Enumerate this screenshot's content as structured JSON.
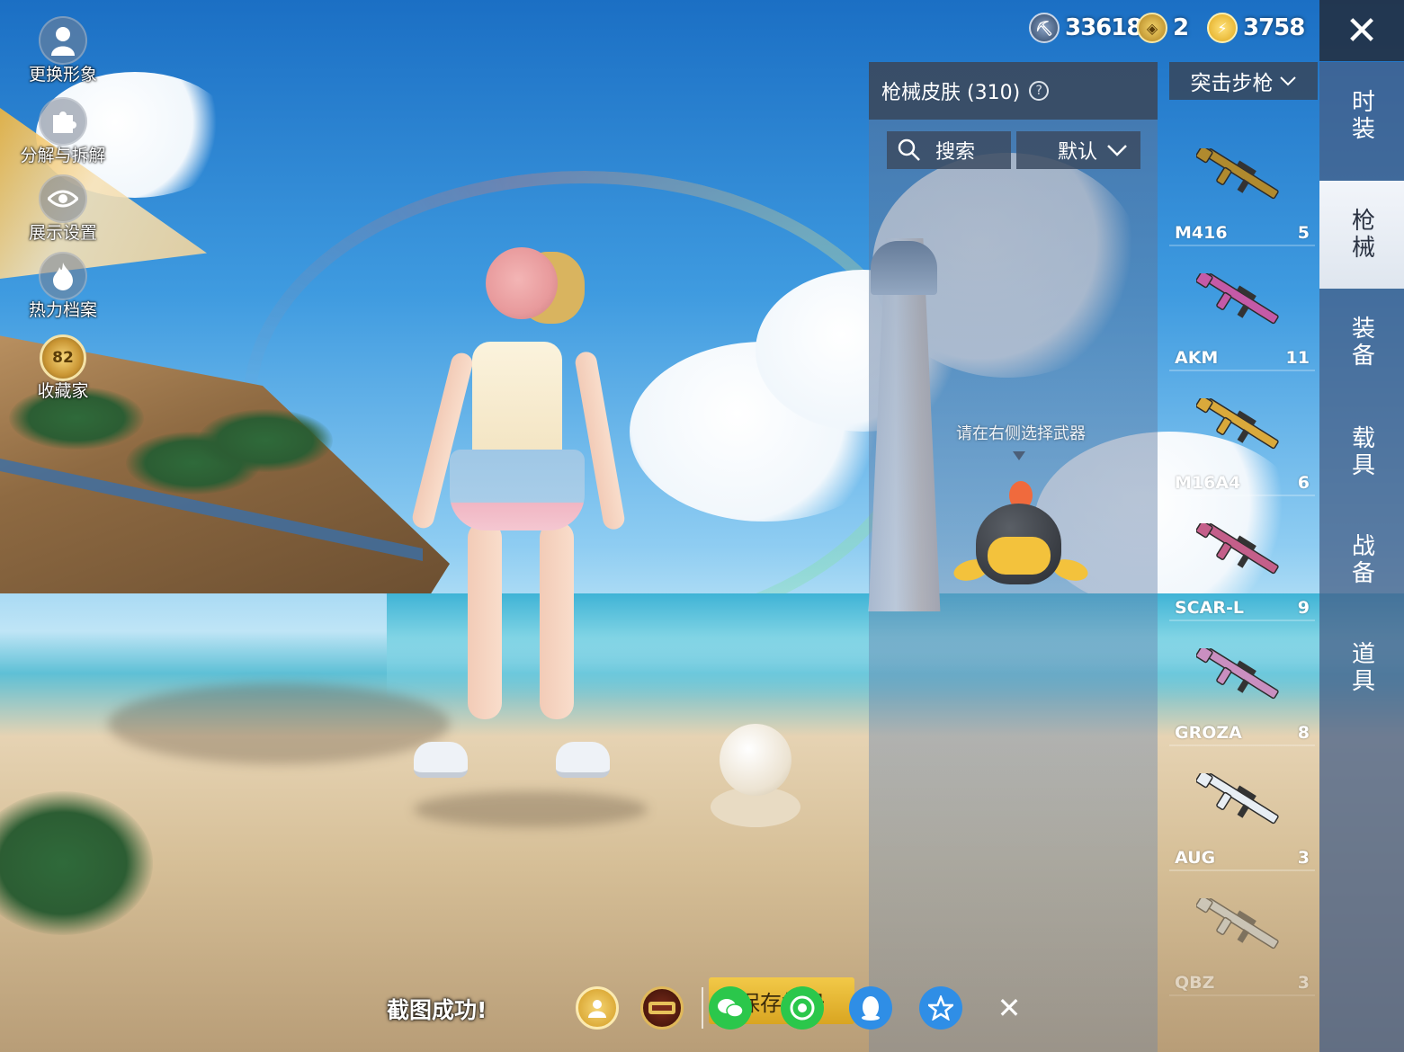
{
  "left_menu": [
    {
      "label": "更换形象",
      "icon": "person-icon"
    },
    {
      "label": "分解与拆解",
      "icon": "puzzle-icon"
    },
    {
      "label": "展示设置",
      "icon": "eye-icon"
    },
    {
      "label": "热力档案",
      "icon": "flame-icon"
    },
    {
      "label": "收藏家",
      "icon": "collector-badge-icon",
      "badge": "82"
    }
  ],
  "currency": {
    "coin": "33618",
    "tokens": "2",
    "energy": "3758"
  },
  "panel": {
    "title": "枪械皮肤 (310)",
    "help": "?",
    "search_label": "搜索",
    "sort_label": "默认",
    "hint": "请在右侧选择武器"
  },
  "category": {
    "label": "突击步枪"
  },
  "weapons": [
    {
      "name": "M416",
      "count": "5",
      "color": "#b08a2e"
    },
    {
      "name": "AKM",
      "count": "11",
      "color": "#c45aa7"
    },
    {
      "name": "M16A4",
      "count": "6",
      "color": "#d9a93b"
    },
    {
      "name": "SCAR-L",
      "count": "9",
      "color": "#c45f8a"
    },
    {
      "name": "GROZA",
      "count": "8",
      "color": "#c98fc0"
    },
    {
      "name": "AUG",
      "count": "3",
      "color": "#e8eef4"
    },
    {
      "name": "QBZ",
      "count": "3",
      "color": "#c9d4de"
    }
  ],
  "tabs": [
    {
      "label": "时装"
    },
    {
      "label": "枪械",
      "active": true
    },
    {
      "label": "装备"
    },
    {
      "label": "载具"
    },
    {
      "label": "战备"
    },
    {
      "label": "道具"
    }
  ],
  "bottom": {
    "toast": "截图成功!",
    "save_label": "保存相册"
  },
  "close_symbol": "✕"
}
